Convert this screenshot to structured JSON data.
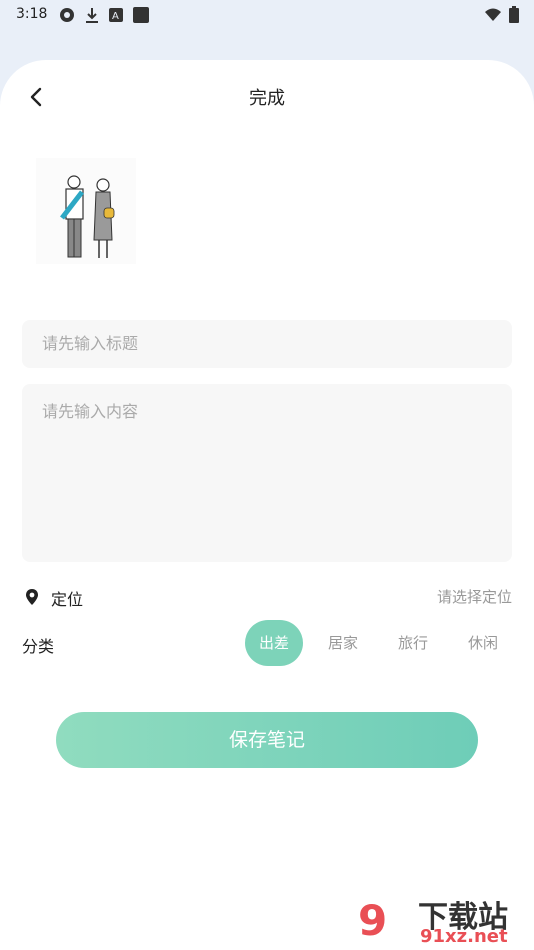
{
  "status_bar": {
    "time": "3:18"
  },
  "header": {
    "title": "完成"
  },
  "form": {
    "title_placeholder": "请先输入标题",
    "content_placeholder": "请先输入内容"
  },
  "location": {
    "label": "定位",
    "value": "请选择定位"
  },
  "category": {
    "label": "分类",
    "options": [
      "出差",
      "居家",
      "旅行",
      "休闲"
    ],
    "selected": "出差"
  },
  "save_label": "保存笔记",
  "watermark": {
    "brand": "下载站",
    "url": "91xz.net",
    "mark": "9"
  },
  "colors": {
    "accent": "#7dd3b9",
    "button_start": "#90dcbf",
    "button_end": "#6ecdb8",
    "background": "#e9eff8"
  }
}
